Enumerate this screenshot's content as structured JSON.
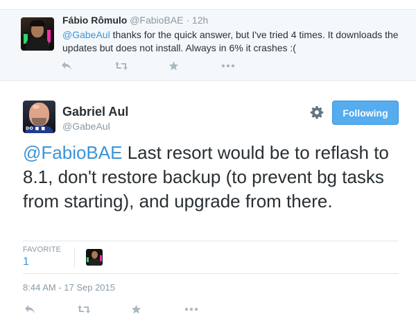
{
  "reply_tweet": {
    "author_name": "Fábio Rômulo",
    "author_handle": "@FabioBAE",
    "separator": "·",
    "time": "12h",
    "mention": "@GabeAul",
    "text": " thanks for the quick answer, but I've tried 4 times. It downloads the updates but does not install. Always in 6% it crashes :("
  },
  "main_tweet": {
    "author_name": "Gabriel Aul",
    "author_handle": "@GabeAul",
    "follow_button_label": "Following",
    "mention": "@FabioBAE",
    "text": " Last resort would be to reflash to 8.1, don't restore backup (to prevent bg tasks from starting), and upgrade from there.",
    "favorite_label": "FAVORITE",
    "favorite_count": "1",
    "timestamp": "8:44 AM - 17 Sep 2015",
    "avatar_badge": "DO  ■  ■"
  },
  "icons": {
    "reply": "reply-icon",
    "retweet": "retweet-icon",
    "favorite": "favorite-star-icon",
    "more": "more-dots-icon",
    "settings": "gear-icon"
  },
  "colors": {
    "link": "#3b94d9",
    "follow_button": "#55acee",
    "muted": "#8899a6",
    "action_icon": "#aab8c2",
    "reply_background": "#f5f8fa"
  }
}
